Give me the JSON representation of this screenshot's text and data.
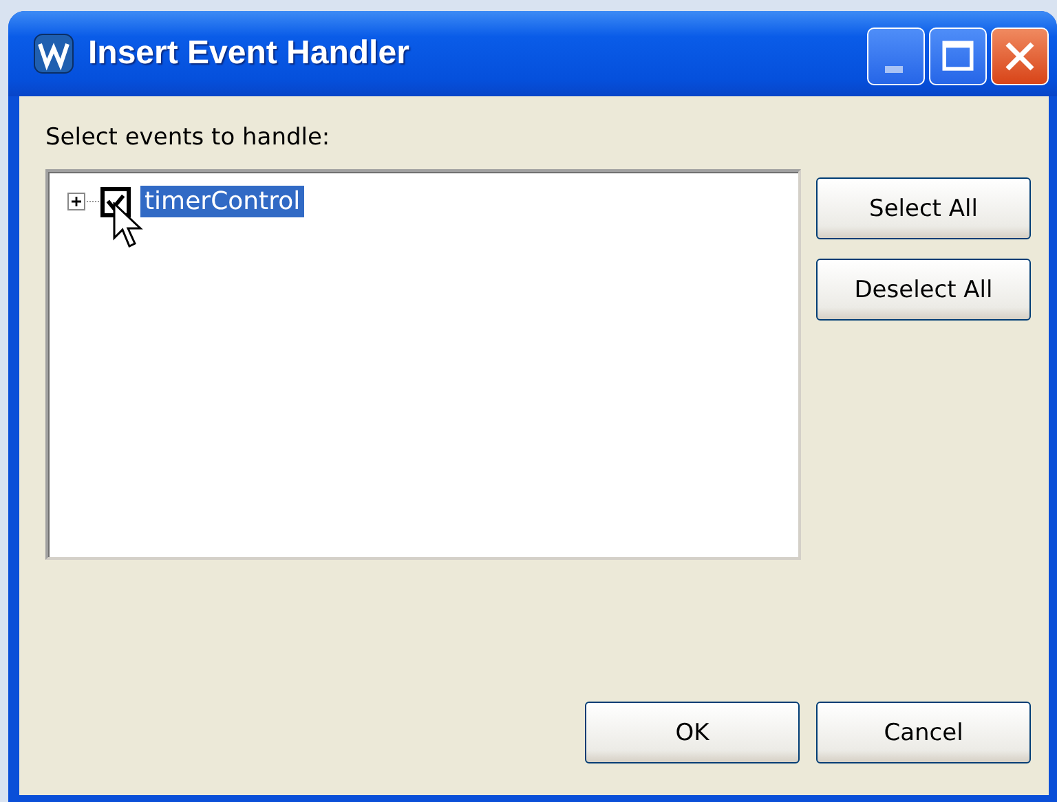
{
  "window": {
    "title": "Insert Event Handler"
  },
  "prompt": "Select events to handle:",
  "tree": {
    "items": [
      {
        "label": "timerControl",
        "expanded": false,
        "checked": true,
        "selected": true
      }
    ]
  },
  "side_buttons": [
    "Select All",
    "Deselect All"
  ],
  "buttons": [
    "OK",
    "Cancel"
  ]
}
